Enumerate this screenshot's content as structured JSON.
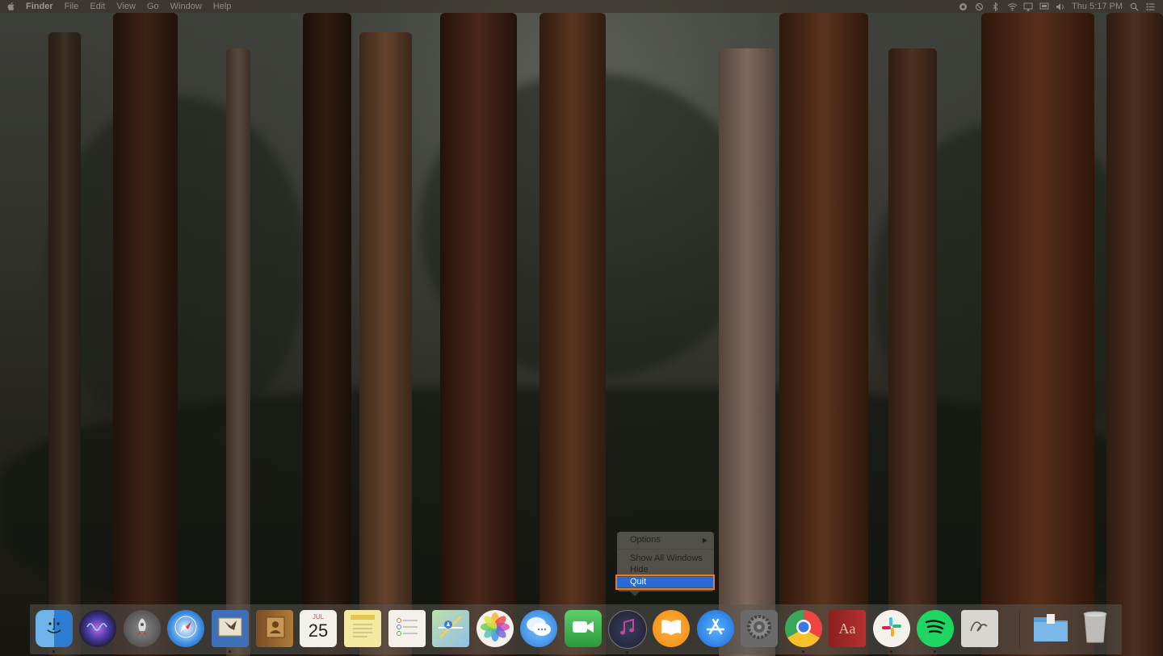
{
  "menubar": {
    "app_name": "Finder",
    "menus": [
      "File",
      "Edit",
      "View",
      "Go",
      "Window",
      "Help"
    ],
    "status_icons": [
      "screen-recording-icon",
      "sync-icon",
      "bluetooth-icon",
      "wifi-icon",
      "airplay-icon",
      "display-icon",
      "volume-icon"
    ],
    "clock": "Thu 5:17 PM",
    "right_icons": [
      "spotlight-icon",
      "notification-center-icon"
    ]
  },
  "context_menu": {
    "items": [
      {
        "label": "Options",
        "has_submenu": true
      },
      {
        "label": "Show All Windows"
      },
      {
        "label": "Hide"
      },
      {
        "label": "Quit",
        "highlighted": true
      }
    ]
  },
  "dock": {
    "calendar": {
      "month": "JUL",
      "day": "25"
    },
    "dictionary_glyph": "Aa",
    "apps": [
      {
        "name": "Finder",
        "icon": "finder-icon",
        "running": true
      },
      {
        "name": "Siri",
        "icon": "siri-icon",
        "running": false
      },
      {
        "name": "Launchpad",
        "icon": "launchpad-icon",
        "running": false
      },
      {
        "name": "Safari",
        "icon": "safari-icon",
        "running": false
      },
      {
        "name": "Mail",
        "icon": "mail-icon",
        "running": true
      },
      {
        "name": "Contacts",
        "icon": "contacts-icon",
        "running": false
      },
      {
        "name": "Calendar",
        "icon": "calendar-icon",
        "running": false
      },
      {
        "name": "Notes",
        "icon": "notes-icon",
        "running": false
      },
      {
        "name": "Reminders",
        "icon": "reminders-icon",
        "running": false
      },
      {
        "name": "Maps",
        "icon": "maps-icon",
        "running": false
      },
      {
        "name": "Photos",
        "icon": "photos-icon",
        "running": false
      },
      {
        "name": "Messages",
        "icon": "messages-icon",
        "running": false
      },
      {
        "name": "FaceTime",
        "icon": "facetime-icon",
        "running": false
      },
      {
        "name": "iTunes",
        "icon": "itunes-icon",
        "running": true
      },
      {
        "name": "Books",
        "icon": "books-icon",
        "running": false
      },
      {
        "name": "App Store",
        "icon": "app-store-icon",
        "running": false
      },
      {
        "name": "System Preferences",
        "icon": "system-preferences-icon",
        "running": false
      },
      {
        "name": "Chrome",
        "icon": "chrome-icon",
        "running": true
      },
      {
        "name": "Dictionary",
        "icon": "dictionary-icon",
        "running": false
      },
      {
        "name": "Slack",
        "icon": "slack-icon",
        "running": true
      },
      {
        "name": "Spotify",
        "icon": "spotify-icon",
        "running": true
      },
      {
        "name": "Script Editor",
        "icon": "script-editor-icon",
        "running": false
      }
    ],
    "stacks": [
      {
        "name": "Downloads",
        "icon": "downloads-folder-icon"
      },
      {
        "name": "Trash",
        "icon": "trash-icon"
      }
    ]
  },
  "colors": {
    "highlight": "#2a6ad6",
    "annotation_box": "#e67a2e"
  }
}
